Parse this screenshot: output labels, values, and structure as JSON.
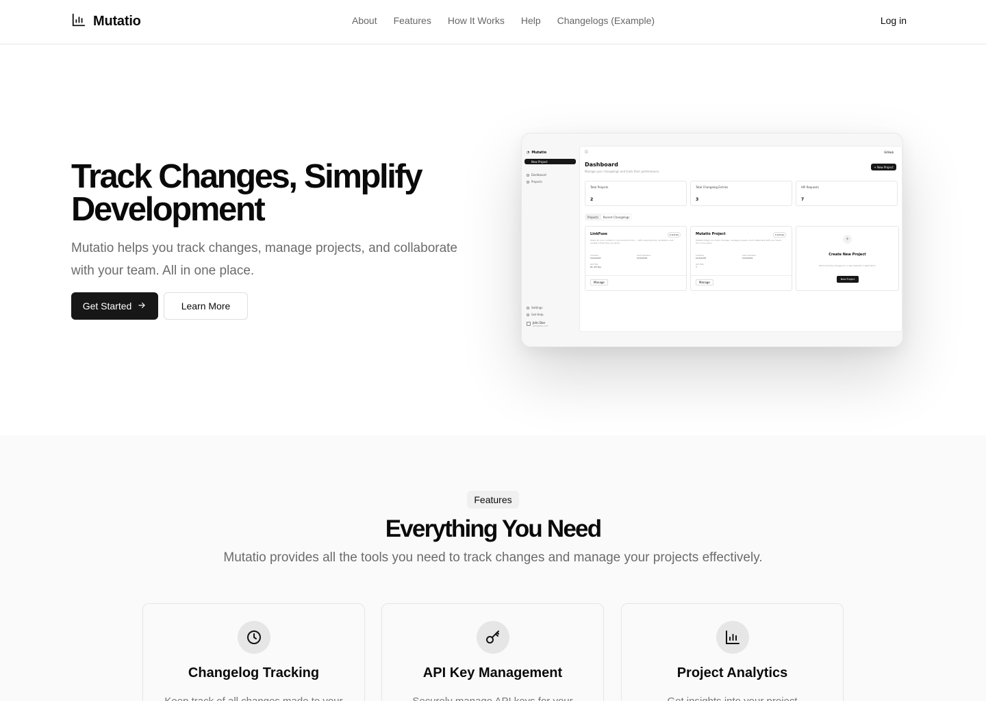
{
  "nav": {
    "brand": "Mutatio",
    "links": [
      "About",
      "Features",
      "How It Works",
      "Help",
      "Changelogs (Example)"
    ],
    "login": "Log in"
  },
  "hero": {
    "title": "Track Changes, Simplify Development",
    "subtitle": "Mutatio helps you track changes, manage projects, and collaborate with your team. All in one place.",
    "cta_primary": "Get Started",
    "cta_secondary": "Learn More"
  },
  "mockup": {
    "app_name": "Mutatio",
    "new_project": "New Project",
    "nav": [
      "Dashboard",
      "Projects"
    ],
    "footer_nav": [
      "Settings",
      "Get Help"
    ],
    "user_name": "John Doe",
    "user_email": "john@doe.com",
    "github": "GitHub",
    "title": "Dashboard",
    "subtitle": "Manage your changelogs and track their performance.",
    "new_button": "+ New Project",
    "stats": [
      {
        "label": "Total Projects",
        "value": "2"
      },
      {
        "label": "Total Changelog Entries",
        "value": "3"
      },
      {
        "label": "API Requests",
        "value": "7"
      }
    ],
    "tabs": [
      "Projects",
      "Recent Changelogs"
    ],
    "cards": [
      {
        "name": "LinkFuse",
        "badge": "0 entries",
        "desc": "Share all your content in one smart bio link — with expiring links, donations, and analytics that help you grow.",
        "created_label": "Created",
        "created": "5/16/2025",
        "updated_label": "Last Updated",
        "updated": "5/16/2025",
        "api_label": "API Hits",
        "api": "No API Key",
        "manage": "Manage"
      },
      {
        "name": "Mutatio Project",
        "badge": "3 entries",
        "desc": "Mutatio helps you track changes, manage projects, and collaborate with your team. All in one place.",
        "created_label": "Created",
        "created": "5/16/2025",
        "updated_label": "Last Updated",
        "updated": "5/16/2025",
        "api_label": "API Hits",
        "api": "7",
        "manage": "Manage"
      }
    ],
    "create": {
      "title": "Create New Project",
      "desc": "Start tracking changes for a new website or application",
      "button": "New Project"
    }
  },
  "features": {
    "pill": "Features",
    "title": "Everything You Need",
    "subtitle": "Mutatio provides all the tools you need to track changes and manage your projects effectively.",
    "cards": [
      {
        "icon": "clock-icon",
        "title": "Changelog Tracking",
        "desc": "Keep track of all changes made to your"
      },
      {
        "icon": "key-icon",
        "title": "API Key Management",
        "desc": "Securely manage API keys for your"
      },
      {
        "icon": "bar-chart-icon",
        "title": "Project Analytics",
        "desc": "Get insights into your project"
      }
    ]
  }
}
